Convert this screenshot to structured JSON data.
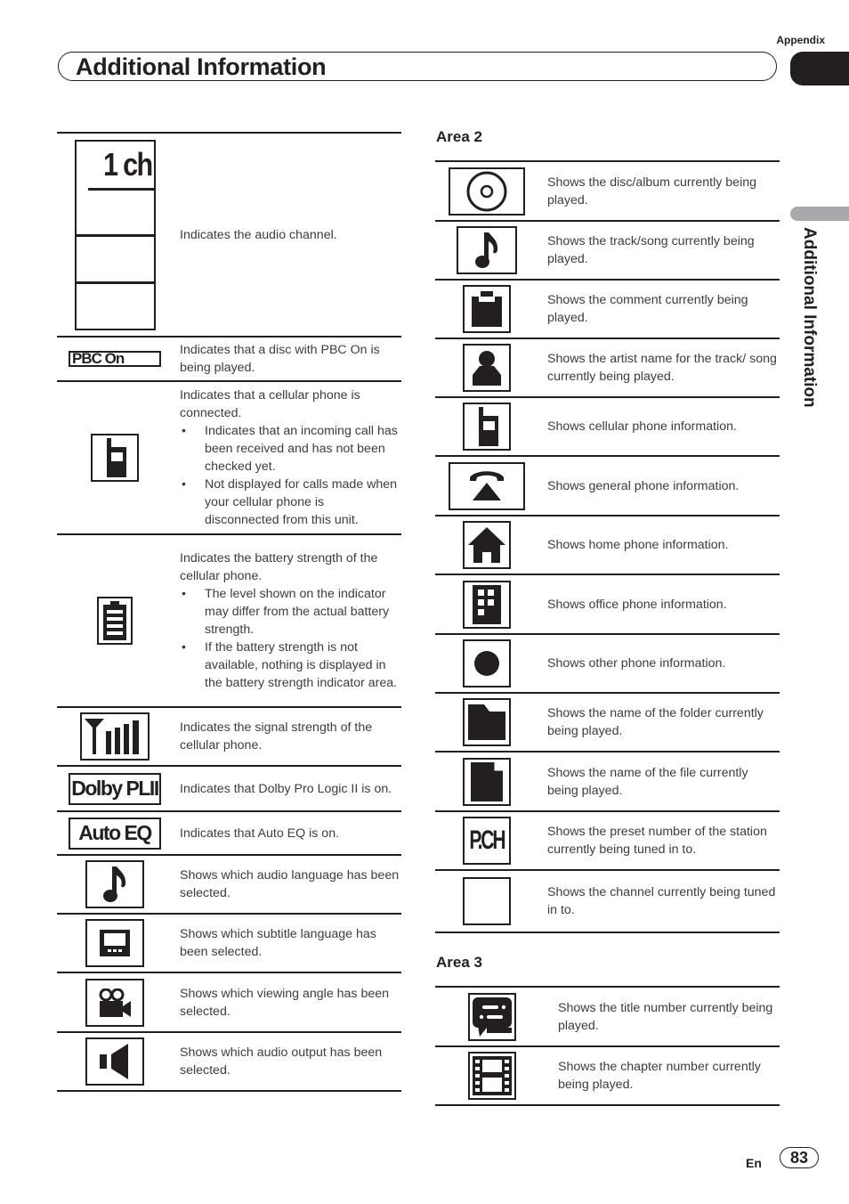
{
  "header": {
    "section": "Appendix",
    "title": "Additional Information",
    "side_label": "Additional Information"
  },
  "left_table": [
    {
      "icon": "audio-channel-indicator",
      "icon_text": "1 ch",
      "text": "Indicates the audio channel.",
      "bullets": []
    },
    {
      "icon": "pbc-on-indicator",
      "icon_text": "PBC On",
      "text": "Indicates that a disc with PBC On is being played.",
      "bullets": []
    },
    {
      "icon": "cellular-phone-icon",
      "text": "Indicates that a cellular phone is connected.",
      "bullets": [
        "Indicates that an incoming call has been received and has not been checked yet.",
        "Not displayed for calls made when your cellular phone is disconnected from this unit."
      ]
    },
    {
      "icon": "battery-icon",
      "text": "Indicates the battery strength of the cellular phone.",
      "bullets": [
        "The level shown on the indicator may differ from the actual battery strength.",
        "If the battery strength is not available, nothing is displayed in the battery strength indicator area."
      ]
    },
    {
      "icon": "signal-strength-icon",
      "text": "Indicates the signal strength of the cellular phone.",
      "bullets": []
    },
    {
      "icon": "dolby-pl2-indicator",
      "icon_text": "Dolby PLII",
      "text": "Indicates that Dolby Pro Logic II is on.",
      "bullets": []
    },
    {
      "icon": "auto-eq-indicator",
      "icon_text": "Auto EQ",
      "text": "Indicates that Auto EQ is on.",
      "bullets": []
    },
    {
      "icon": "music-note-icon",
      "text": "Shows which audio language has been selected.",
      "bullets": []
    },
    {
      "icon": "subtitle-icon",
      "text": "Shows which subtitle language has been selected.",
      "bullets": []
    },
    {
      "icon": "camera-angle-icon",
      "text": "Shows which viewing angle has been selected.",
      "bullets": []
    },
    {
      "icon": "speaker-icon",
      "text": "Shows which audio output has been selected.",
      "bullets": []
    }
  ],
  "area2": {
    "heading": "Area 2",
    "rows": [
      {
        "icon": "disc-icon",
        "text": "Shows the disc/album currently being played."
      },
      {
        "icon": "music-note-icon",
        "text": "Shows the track/song currently being played."
      },
      {
        "icon": "comment-icon",
        "text": "Shows the comment currently being played."
      },
      {
        "icon": "artist-icon",
        "text": "Shows the artist name for the track/ song currently being played."
      },
      {
        "icon": "cellular-phone-icon",
        "text": "Shows cellular phone information."
      },
      {
        "icon": "general-phone-icon",
        "text": "Shows general phone information."
      },
      {
        "icon": "home-icon",
        "text": "Shows home phone information."
      },
      {
        "icon": "office-icon",
        "text": "Shows office phone information."
      },
      {
        "icon": "other-phone-icon",
        "text": "Shows other phone information."
      },
      {
        "icon": "folder-icon",
        "text": "Shows the name of the folder currently being played."
      },
      {
        "icon": "file-icon",
        "text": "Shows the name of the file currently being played."
      },
      {
        "icon": "preset-channel-icon",
        "icon_text": "P.CH",
        "text": "Shows the preset number of the station currently being tuned in to."
      },
      {
        "icon": "channel-icon",
        "text": "Shows the channel currently being tuned in to."
      }
    ]
  },
  "area3": {
    "heading": "Area 3",
    "rows": [
      {
        "icon": "title-icon",
        "text": "Shows the title number currently being played."
      },
      {
        "icon": "chapter-icon",
        "text": "Shows the chapter number currently being played."
      }
    ]
  },
  "footer": {
    "language": "En",
    "page_number": "83"
  }
}
